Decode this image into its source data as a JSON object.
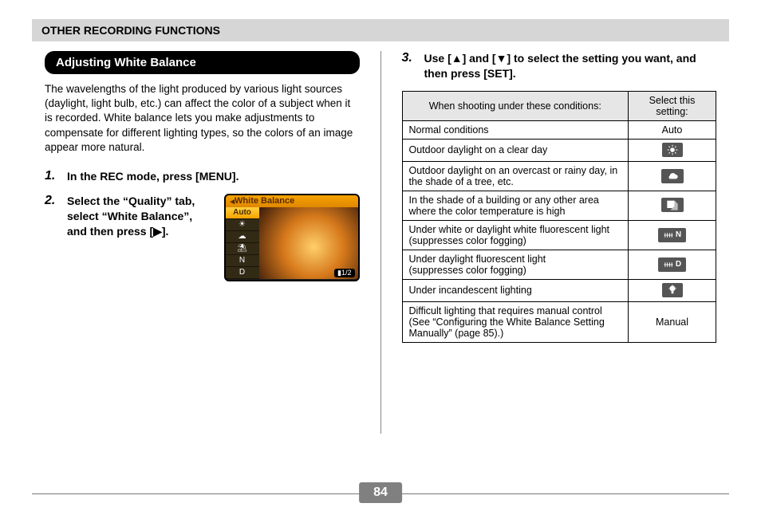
{
  "header": "OTHER RECORDING FUNCTIONS",
  "section_title": "Adjusting White Balance",
  "intro": "The wavelengths of the light produced by various light sources (daylight, light bulb, etc.) can affect the color of a subject when it is recorded. White balance lets you make adjustments to compensate for different lighting types, so the colors of an image appear more natural.",
  "steps": {
    "s1": {
      "num": "1.",
      "text": "In the REC mode, press [MENU]."
    },
    "s2": {
      "num": "2.",
      "text": "Select the “Quality” tab, select “White Balance”, and then press [▶]."
    },
    "s3": {
      "num": "3.",
      "text": "Use [▲] and [▼] to select the setting you want, and then press [SET]."
    }
  },
  "cam": {
    "title": "White Balance",
    "items": [
      "Auto",
      "☀",
      "☁",
      "⛱",
      "N",
      "D"
    ],
    "page": "1/2"
  },
  "table": {
    "head_condition": "When shooting under these conditions:",
    "head_setting": "Select this setting:",
    "rows": [
      {
        "condition": "Normal conditions",
        "setting_text": "Auto",
        "icon": null
      },
      {
        "condition": "Outdoor daylight on a clear day",
        "icon": "sun"
      },
      {
        "condition": "Outdoor daylight on an overcast or rainy day, in the shade of a tree, etc.",
        "icon": "cloud"
      },
      {
        "condition": "In the shade of a building or any other area where the color temperature is high",
        "icon": "shade"
      },
      {
        "condition": "Under white or daylight white fluorescent light\n(suppresses color fogging)",
        "icon": "fluor",
        "label": "N"
      },
      {
        "condition": "Under daylight fluorescent light\n(suppresses color fogging)",
        "icon": "fluor",
        "label": "D"
      },
      {
        "condition": "Under incandescent lighting",
        "icon": "bulb"
      },
      {
        "condition": "Difficult lighting that requires manual control (See “Configuring the White Balance Setting Manually” (page 85).)",
        "setting_text": "Manual",
        "icon": null
      }
    ]
  },
  "page_number": "84"
}
